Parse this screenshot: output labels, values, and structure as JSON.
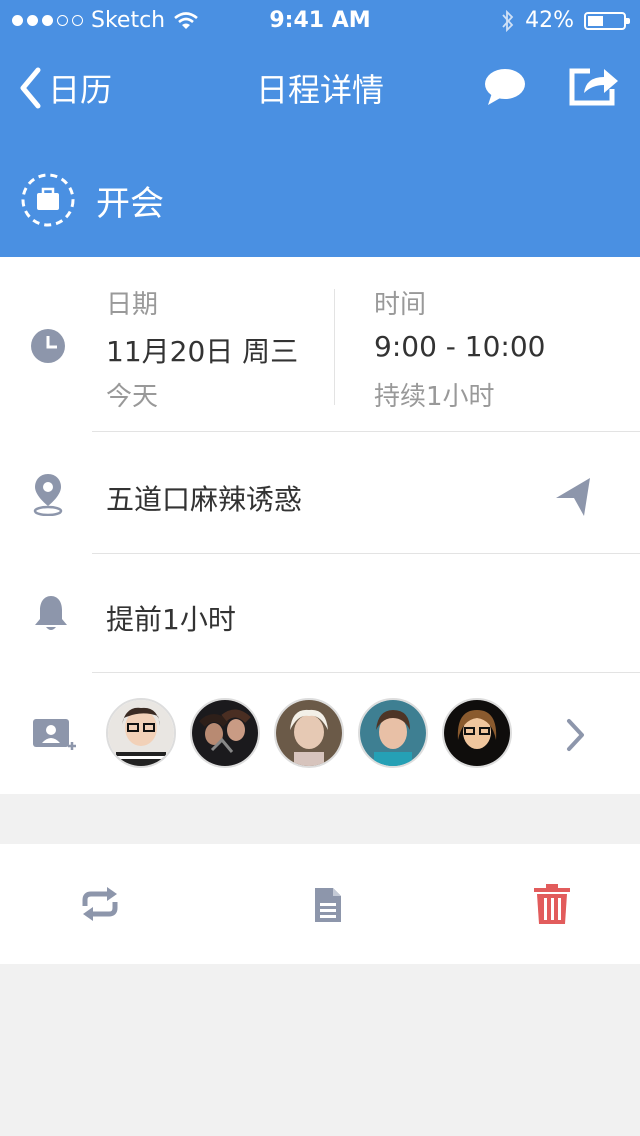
{
  "status_bar": {
    "carrier": "Sketch",
    "time": "9:41 AM",
    "battery": "42%"
  },
  "nav": {
    "back_label": "日历",
    "title": "日程详情"
  },
  "event": {
    "title": "开会"
  },
  "date_time": {
    "date_label": "日期",
    "date_value": "11月20日 周三",
    "date_sub": "今天",
    "time_label": "时间",
    "time_value": "9:00 - 10:00",
    "time_sub": "持续1小时"
  },
  "location": {
    "text": "五道口麻辣诱惑"
  },
  "reminder": {
    "text": "提前1小时"
  },
  "participants": {
    "avatars": [
      "avatar-1",
      "avatar-2",
      "avatar-3",
      "avatar-4",
      "avatar-5"
    ]
  },
  "colors": {
    "primary": "#4a90e2",
    "icon_gray": "#8d96ab",
    "delete_red": "#e25c5c"
  }
}
